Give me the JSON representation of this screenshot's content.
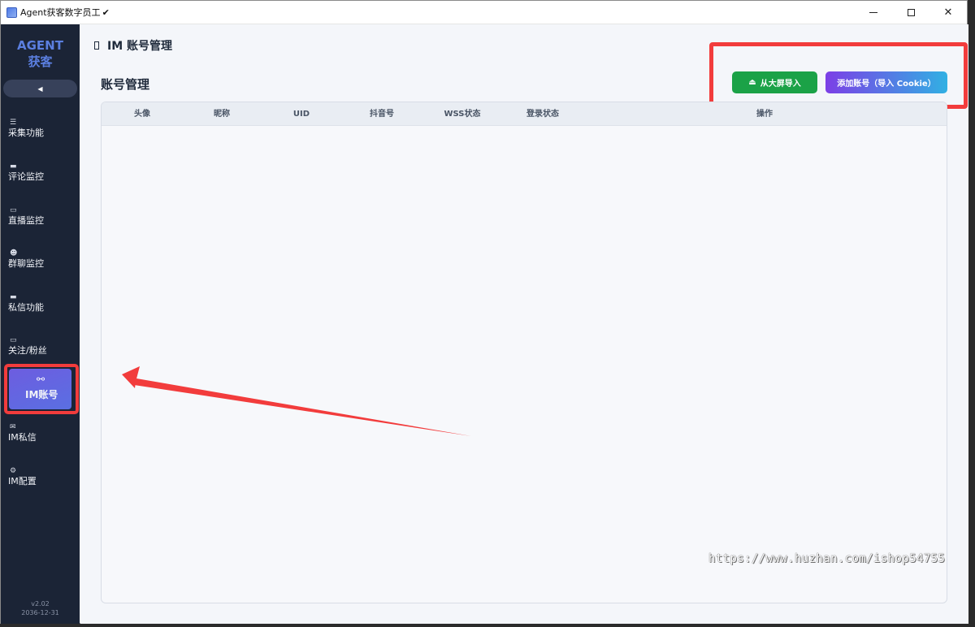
{
  "window": {
    "title": "Agent获客数字员工",
    "title_suffix": "✔",
    "controls": {
      "close": "✕"
    }
  },
  "sidebar": {
    "brand_line1": "AGENT",
    "brand_line2": "获客",
    "collapse_glyph": "◀",
    "items": [
      {
        "label": "采集功能",
        "icon": "list-icon",
        "glyph": "☰"
      },
      {
        "label": "评论监控",
        "icon": "chat-icon",
        "glyph": "▬"
      },
      {
        "label": "直播监控",
        "icon": "tv-icon",
        "glyph": "▭"
      },
      {
        "label": "群聊监控",
        "icon": "group-icon",
        "glyph": "☻"
      },
      {
        "label": "私信功能",
        "icon": "mail-icon",
        "glyph": "▬"
      },
      {
        "label": "关注/粉丝",
        "icon": "monitor-icon",
        "glyph": "▭"
      },
      {
        "label": "IM账号",
        "icon": "link-icon",
        "glyph": "⚯",
        "active": true
      },
      {
        "label": "IM私信",
        "icon": "envelope-icon",
        "glyph": "✉"
      },
      {
        "label": "IM配置",
        "icon": "gear-icon",
        "glyph": "⚙"
      }
    ],
    "version": "v2.02",
    "expiry": "2036-12-31"
  },
  "main": {
    "page_title": "IM 账号管理",
    "section_title": "账号管理",
    "buttons": {
      "import_screen": "从大屏导入",
      "add_account": "添加账号（导入 Cookie）"
    },
    "table": {
      "columns": [
        "头像",
        "昵称",
        "UID",
        "抖音号",
        "WSS状态",
        "登录状态",
        "操作"
      ],
      "rows": []
    }
  },
  "watermark": "https://www.huzhan.com/ishop54755",
  "colors": {
    "sidebar_bg": "#1b2436",
    "brand": "#5b7fe0",
    "active_nav": "#6d5de0",
    "import_button": "#1ba247",
    "add_button_start": "#7c3fe6",
    "add_button_end": "#31b0e3",
    "annotation": "#f23c3c"
  }
}
